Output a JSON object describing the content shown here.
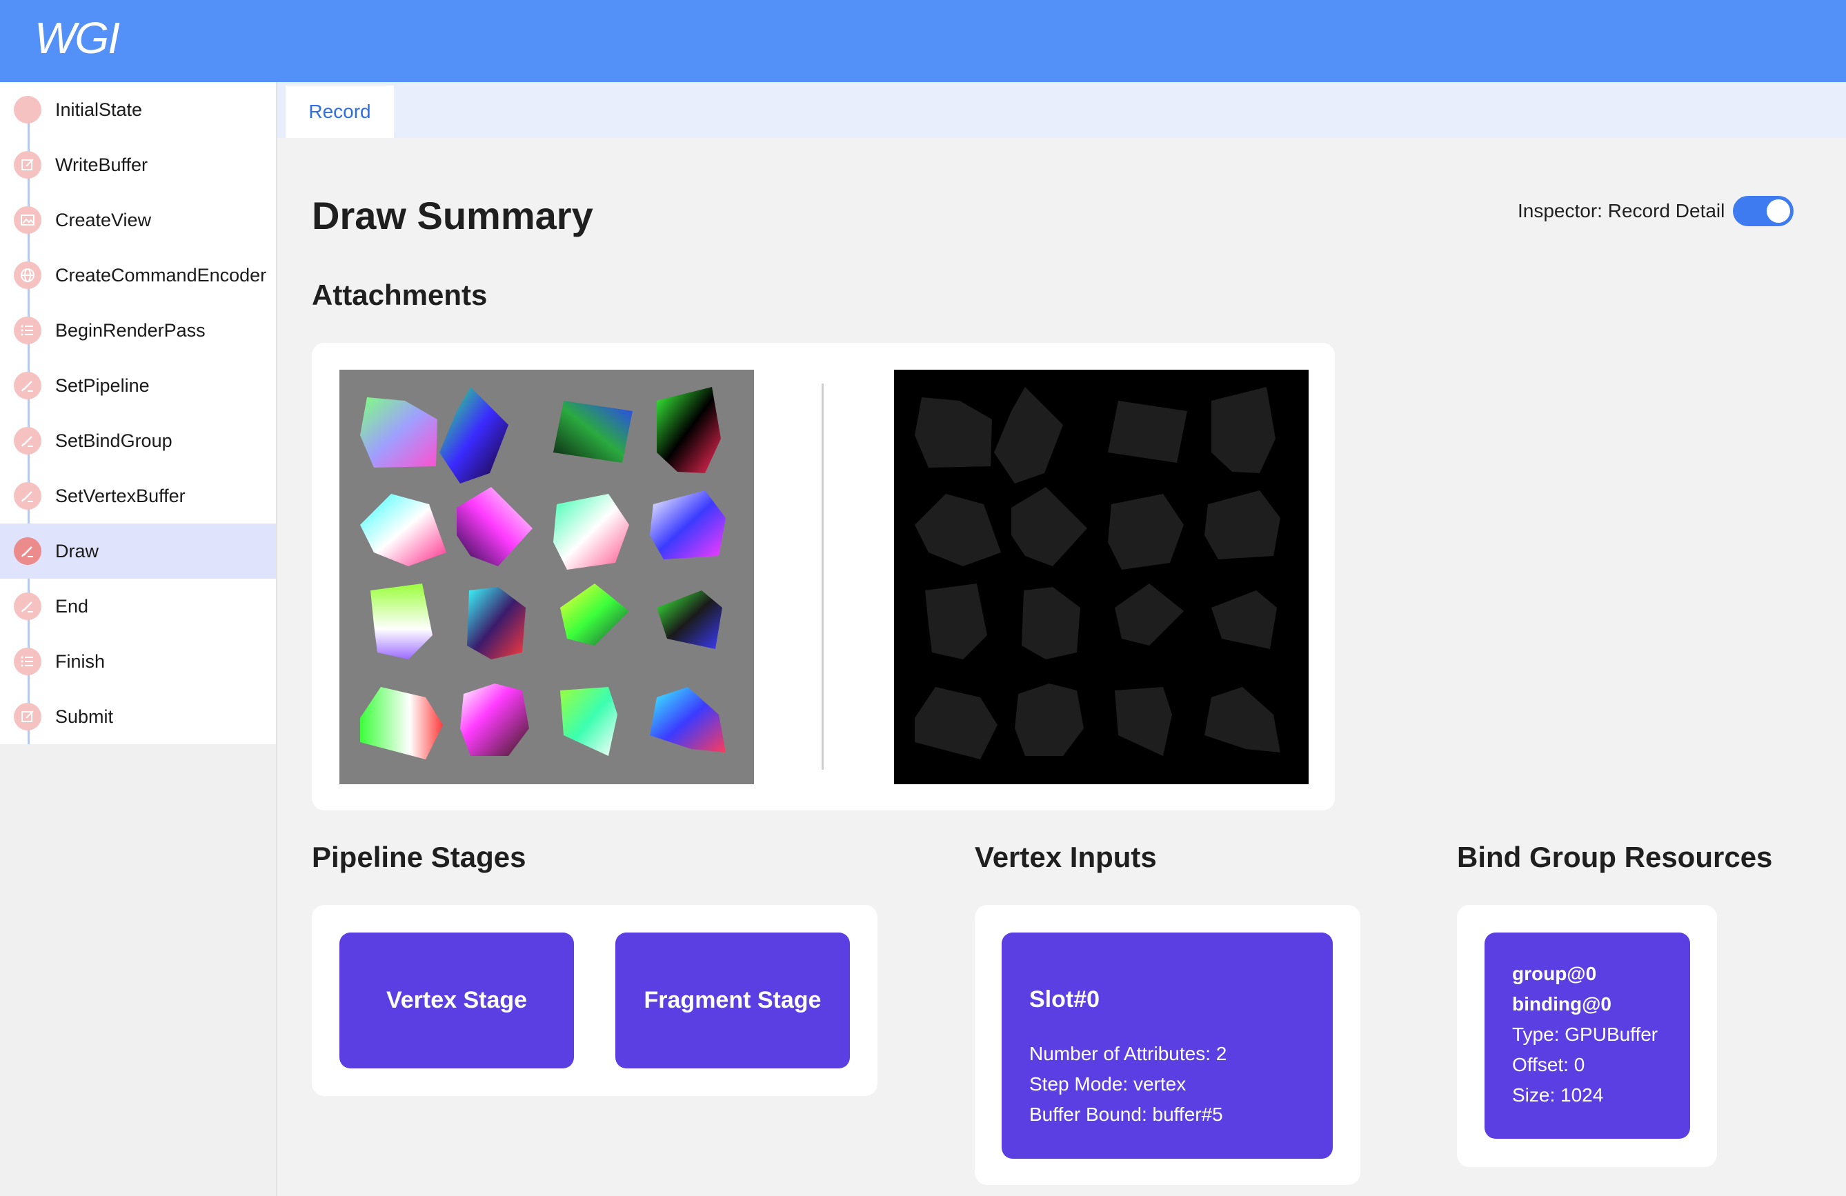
{
  "app": {
    "logo": "WGI"
  },
  "sidebar": {
    "items": [
      {
        "label": "InitialState",
        "icon": "circle-icon"
      },
      {
        "label": "WriteBuffer",
        "icon": "edit-icon"
      },
      {
        "label": "CreateView",
        "icon": "image-icon"
      },
      {
        "label": "CreateCommandEncoder",
        "icon": "globe-icon"
      },
      {
        "label": "BeginRenderPass",
        "icon": "list-icon"
      },
      {
        "label": "SetPipeline",
        "icon": "brush-icon"
      },
      {
        "label": "SetBindGroup",
        "icon": "brush-icon"
      },
      {
        "label": "SetVertexBuffer",
        "icon": "brush-icon"
      },
      {
        "label": "Draw",
        "icon": "brush-icon",
        "active": true
      },
      {
        "label": "End",
        "icon": "brush-icon"
      },
      {
        "label": "Finish",
        "icon": "list-icon"
      },
      {
        "label": "Submit",
        "icon": "edit-icon"
      }
    ]
  },
  "tabs": [
    {
      "label": "Record",
      "active": true
    }
  ],
  "main": {
    "title": "Draw Summary",
    "inspector_label": "Inspector: Record Detail",
    "inspector_on": true,
    "attachments_heading": "Attachments",
    "pipeline_heading": "Pipeline Stages",
    "vertex_heading": "Vertex Inputs",
    "bindgroup_heading": "Bind Group Resources"
  },
  "pipeline": {
    "stages": [
      {
        "label": "Vertex Stage"
      },
      {
        "label": "Fragment Stage"
      }
    ]
  },
  "vertex_inputs": {
    "slot": "Slot#0",
    "attributes": "Number of Attributes: 2",
    "step_mode": "Step Mode: vertex",
    "buffer": "Buffer Bound: buffer#5"
  },
  "bind_group": {
    "group": "group@0",
    "binding": "binding@0",
    "type": "Type: GPUBuffer",
    "offset": "Offset: 0",
    "size": "Size: 1024"
  },
  "colors": {
    "topbar": "#5390f8",
    "accent_purple": "#5b3fe2",
    "tab_text": "#2f6fe4",
    "step_dot": "#f6c1c1",
    "step_active_bg": "#dfe3fb"
  }
}
